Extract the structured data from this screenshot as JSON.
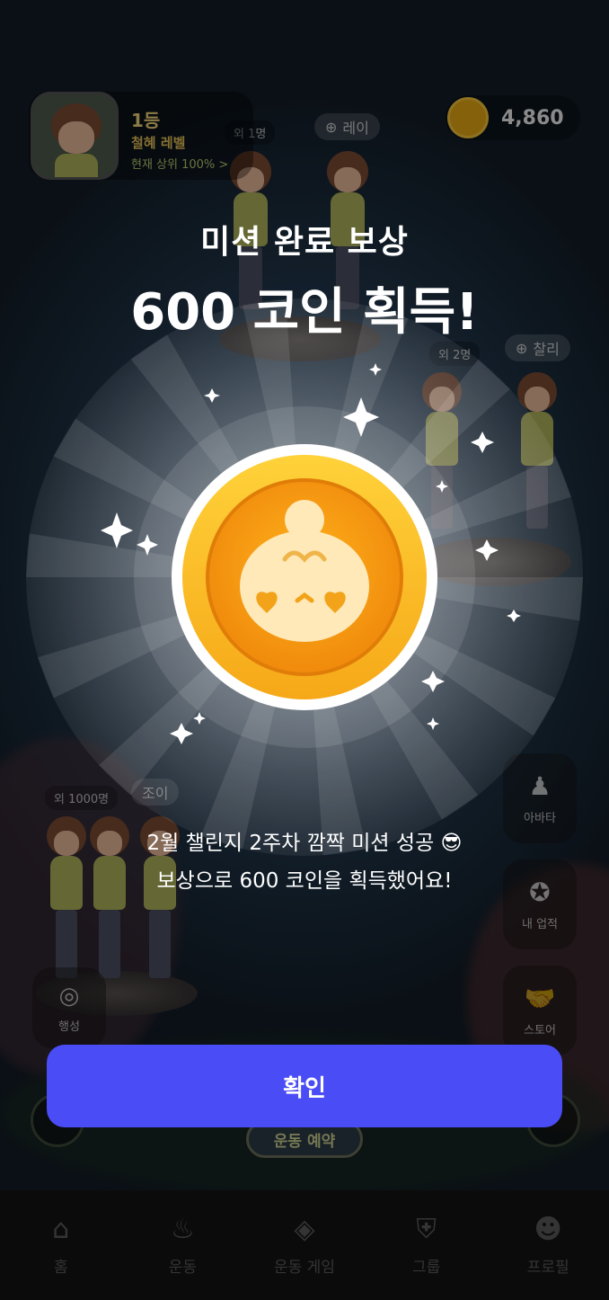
{
  "background": {
    "rank_card": {
      "rank": "1등",
      "level": "철혜 레벨",
      "sub": "현재 상위 100% >"
    },
    "coin_balance": "4,860",
    "labels": {
      "top_count": "외 1명",
      "top_name": "레이",
      "right_count": "외 2명",
      "right_name": "찰리",
      "left_count": "외 1000명",
      "left_name": "조이"
    },
    "side_buttons": [
      {
        "label": "아바타",
        "icon": "avatar-icon"
      },
      {
        "label": "내 업적",
        "icon": "medal-icon"
      },
      {
        "label": "스토어",
        "icon": "handshake-icon"
      }
    ],
    "left_button": {
      "label": "행성",
      "icon": "planet-icon"
    },
    "reserve_button": "운동 예약",
    "tabs": [
      {
        "label": "홈",
        "icon": "home-icon"
      },
      {
        "label": "운동",
        "icon": "flame-icon"
      },
      {
        "label": "운동 게임",
        "icon": "gamepad-icon"
      },
      {
        "label": "그룹",
        "icon": "shield-icon"
      },
      {
        "label": "프로필",
        "icon": "person-icon"
      }
    ]
  },
  "modal": {
    "subtitle": "미션 완료 보상",
    "title": "600 코인 획득!",
    "description_line1": "2월 챌린지 2주차 깜짝 미션 성공 😎",
    "description_line2": "보상으로 600 코인을 획득했어요!",
    "confirm_label": "확인",
    "coin_color": "#f7a81b",
    "accent_color": "#4a4cf6"
  }
}
